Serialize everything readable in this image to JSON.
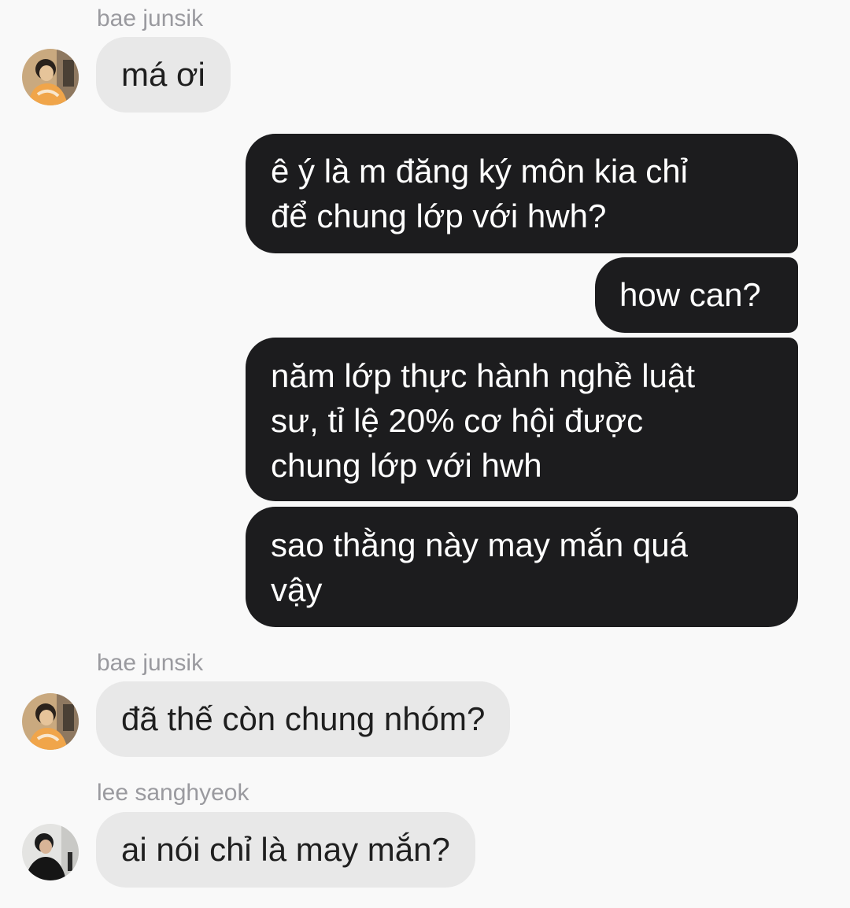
{
  "messages": [
    {
      "sender": "bae junsik",
      "text": "má ơi"
    },
    {
      "text_lines": [
        "ê ý là m đăng ký môn kia chỉ",
        "để chung lớp với hwh?"
      ]
    },
    {
      "text": "how can?"
    },
    {
      "text_lines": [
        "năm lớp thực hành nghề luật",
        "sư, tỉ lệ 20% cơ hội được",
        "chung lớp với hwh"
      ]
    },
    {
      "text_lines": [
        "sao thằng này may mắn quá",
        "vậy"
      ]
    },
    {
      "sender": "bae junsik",
      "text": "đã thế còn chung nhóm?"
    },
    {
      "sender": "lee sanghyeok",
      "text": "ai nói chỉ là may mắn?"
    }
  ],
  "colors": {
    "background": "#f9f9f9",
    "incoming_bubble": "#e8e8e8",
    "outgoing_bubble": "#1c1c1e",
    "sender_name": "#9a9a9f"
  }
}
